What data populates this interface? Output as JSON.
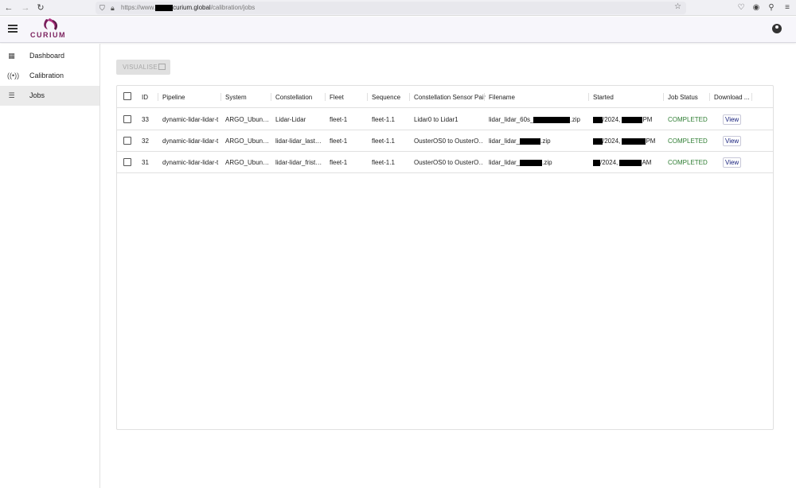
{
  "browser": {
    "url_prefix": "https://www.",
    "url_host": "curium.global",
    "url_path": "/calibration/jobs"
  },
  "app": {
    "logo_text": "CURIUM"
  },
  "sidebar": {
    "items": [
      {
        "label": "Dashboard",
        "icon": "dashboard-icon"
      },
      {
        "label": "Calibration",
        "icon": "sensor-icon"
      },
      {
        "label": "Jobs",
        "icon": "list-icon",
        "active": true
      }
    ]
  },
  "toolbar": {
    "visualise_label": "VISUALISE"
  },
  "table": {
    "columns": [
      "ID",
      "Pipeline",
      "System",
      "Constellation",
      "Fleet",
      "Sequence",
      "Constellation Sensor Pair",
      "Filename",
      "Started",
      "Job Status",
      "Download ..."
    ],
    "rows": [
      {
        "id": "33",
        "pipeline": "dynamic-lidar-lidar-t",
        "system": "ARGO_Ubun…",
        "constellation": "Lidar-Lidar",
        "fleet": "fleet-1",
        "sequence": "fleet-1.1",
        "sensor_pair": "Lidar0 to Lidar1",
        "filename_a": "lidar_lidar_60s_",
        "filename_b": ".zip",
        "started_a": "/2024, ",
        "started_b": "PM",
        "status": "COMPLETED",
        "download": "View"
      },
      {
        "id": "32",
        "pipeline": "dynamic-lidar-lidar-t",
        "system": "ARGO_Ubun…",
        "constellation": "lidar-lidar_last…",
        "fleet": "fleet-1",
        "sequence": "fleet-1.1",
        "sensor_pair": "OusterOS0 to OusterO…",
        "filename_a": "lidar_lidar_",
        "filename_b": ".zip",
        "started_a": "/2024, ",
        "started_b": "PM",
        "status": "COMPLETED",
        "download": "View"
      },
      {
        "id": "31",
        "pipeline": "dynamic-lidar-lidar-t",
        "system": "ARGO_Ubun…",
        "constellation": "lidar-lidar_frist…",
        "fleet": "fleet-1",
        "sequence": "fleet-1.1",
        "sensor_pair": "OusterOS0 to OusterO…",
        "filename_a": "lidar_lidar_",
        "filename_b": ".zip",
        "started_a": "/2024, ",
        "started_b": "AM",
        "status": "COMPLETED",
        "download": "View"
      }
    ]
  },
  "colors": {
    "brand": "#7a1f5c",
    "completed": "#2e7d32"
  }
}
